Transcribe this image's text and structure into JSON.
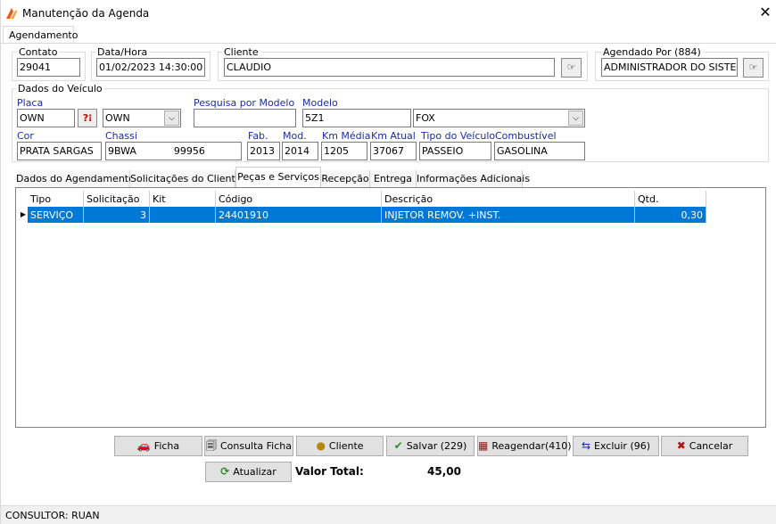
{
  "window": {
    "title": "Manutenção da Agenda",
    "close": "✕",
    "tab": "Agendamento"
  },
  "header": {
    "contato": {
      "label": "Contato",
      "value": "29041"
    },
    "data_hora": {
      "label": "Data/Hora",
      "value": "01/02/2023 14:30:00"
    },
    "cliente": {
      "label": "Cliente",
      "value": "CLAUDIO"
    },
    "agendado_por": {
      "label": "Agendado Por (884)",
      "value": "ADMINISTRADOR DO SISTEMA"
    }
  },
  "veiculo": {
    "group_label": "Dados do Veículo",
    "placa": {
      "label": "Placa",
      "value": "OWN",
      "combo": "OWN"
    },
    "pesquisa_modelo": {
      "label": "Pesquisa por Modelo",
      "value": ""
    },
    "modelo": {
      "label": "Modelo",
      "code": "5Z1",
      "name": "FOX"
    },
    "cor": {
      "label": "Cor",
      "value": "PRATA SARGAS"
    },
    "chassi": {
      "label": "Chassi",
      "value": "9BWA            99956"
    },
    "fab": {
      "label": "Fab.",
      "value": "2013"
    },
    "mod": {
      "label": "Mod.",
      "value": "2014"
    },
    "km_media": {
      "label": "Km Média",
      "value": "1205"
    },
    "km_atual": {
      "label": "Km Atual",
      "value": "37067"
    },
    "tipo": {
      "label": "Tipo do Veículo",
      "value": "PASSEIO"
    },
    "combustivel": {
      "label": "Combustível",
      "value": "GASOLINA"
    }
  },
  "tabs": [
    {
      "label": "Dados do Agendamento"
    },
    {
      "label": "Solicitações do Cliente"
    },
    {
      "label": "Peças e Serviços"
    },
    {
      "label": "Recepção"
    },
    {
      "label": "Entrega"
    },
    {
      "label": "Informações Adicionais"
    }
  ],
  "grid": {
    "columns": [
      "Tipo",
      "Solicitação",
      "Kit",
      "Código",
      "Descrição",
      "Qtd."
    ],
    "rows": [
      {
        "tipo": "SERVIÇO",
        "solicitacao": "3",
        "kit": "",
        "codigo": "24401910",
        "descricao": "INJETOR REMOV. +INST.",
        "qtd": "0,30"
      }
    ]
  },
  "buttons": {
    "ficha": "Ficha",
    "consulta_ficha": "Consulta Ficha",
    "cliente": "Cliente",
    "salvar": "Salvar (229)",
    "reagendar": "Reagendar(410)",
    "excluir": "Excluir (96)",
    "cancelar": "Cancelar",
    "atualizar": "Atualizar"
  },
  "total": {
    "label": "Valor Total:",
    "value": "45,00"
  },
  "status": "CONSULTOR: RUAN",
  "colors": {
    "selection": "#0078d7",
    "label_blue": "#1b2ca8"
  }
}
